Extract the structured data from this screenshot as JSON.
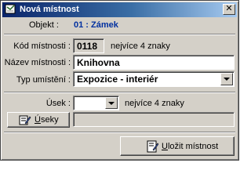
{
  "window": {
    "title": "Nová místnost",
    "close_glyph": "✕"
  },
  "header": {
    "object_label": "Objekt :",
    "object_value": "01 : Zámek"
  },
  "form": {
    "room_code": {
      "label": "Kód místnosti :",
      "value": "0118",
      "hint": "nejvíce 4 znaky"
    },
    "room_name": {
      "label": "Název místnosti :",
      "value": "Knihovna"
    },
    "location_type": {
      "label": "Typ umístění :",
      "value": "Expozice - interiér"
    },
    "section": {
      "label": "Úsek :",
      "value": "",
      "hint": "nejvíce 4 znaky"
    },
    "sections_button": {
      "mnemonic": "Ú",
      "rest": "seky",
      "icon": "edit-note-icon"
    },
    "section_name_value": ""
  },
  "footer": {
    "save_button": {
      "mnemonic": "U",
      "rest": "ložit místnost",
      "icon": "save-document-icon"
    }
  },
  "colors": {
    "accent_text": "#0030a0",
    "title_gradient_start": "#0a246a",
    "title_gradient_end": "#a6caf0",
    "face": "#d4d0c8"
  }
}
